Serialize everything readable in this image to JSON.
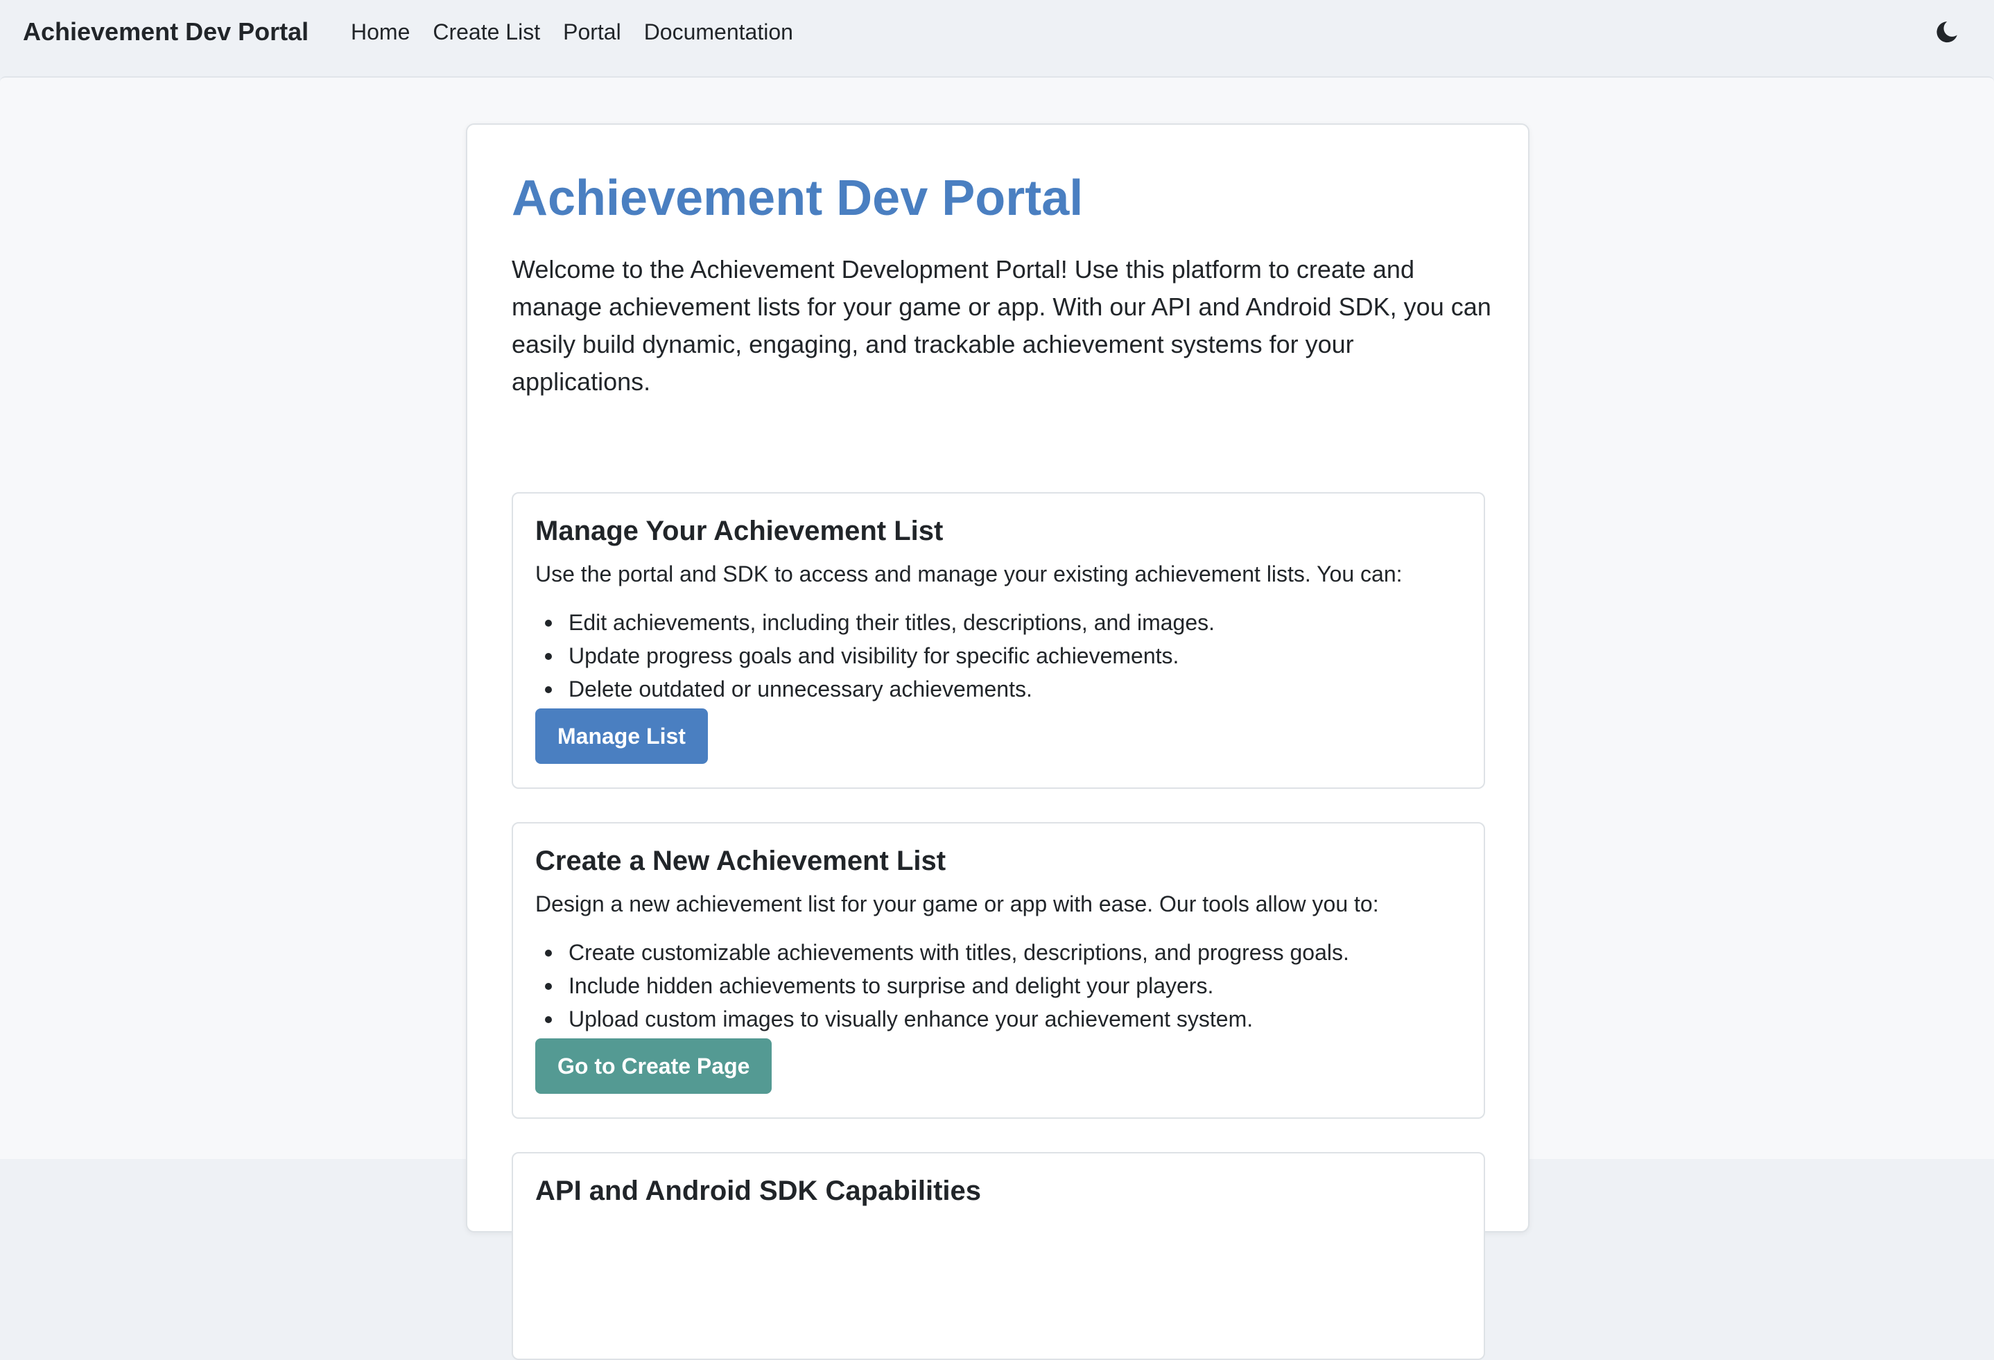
{
  "navbar": {
    "brand": "Achievement Dev Portal",
    "links": [
      {
        "label": "Home"
      },
      {
        "label": "Create List"
      },
      {
        "label": "Portal"
      },
      {
        "label": "Documentation"
      }
    ],
    "theme_toggle_icon": "moon-icon"
  },
  "main": {
    "title": "Achievement Dev Portal",
    "intro": "Welcome to the Achievement Development Portal! Use this platform to create and manage achievement lists for your game or app. With our API and Android SDK, you can easily build dynamic, engaging, and trackable achievement systems for your applications.",
    "sections": [
      {
        "title": "Manage Your Achievement List",
        "description": "Use the portal and SDK to access and manage your existing achievement lists. You can:",
        "bullets": [
          "Edit achievements, including their titles, descriptions, and images.",
          "Update progress goals and visibility for specific achievements.",
          "Delete outdated or unnecessary achievements."
        ],
        "button_label": "Manage List"
      },
      {
        "title": "Create a New Achievement List",
        "description": "Design a new achievement list for your game or app with ease. Our tools allow you to:",
        "bullets": [
          "Create customizable achievements with titles, descriptions, and progress goals.",
          "Include hidden achievements to surprise and delight your players.",
          "Upload custom images to visually enhance your achievement system."
        ],
        "button_label": "Go to Create Page"
      },
      {
        "title": "API and Android SDK Capabilities"
      }
    ]
  },
  "colors": {
    "accent": "#4a7fc1",
    "teal": "#549a93",
    "navbar_bg": "#eef1f5",
    "text": "#212529"
  }
}
